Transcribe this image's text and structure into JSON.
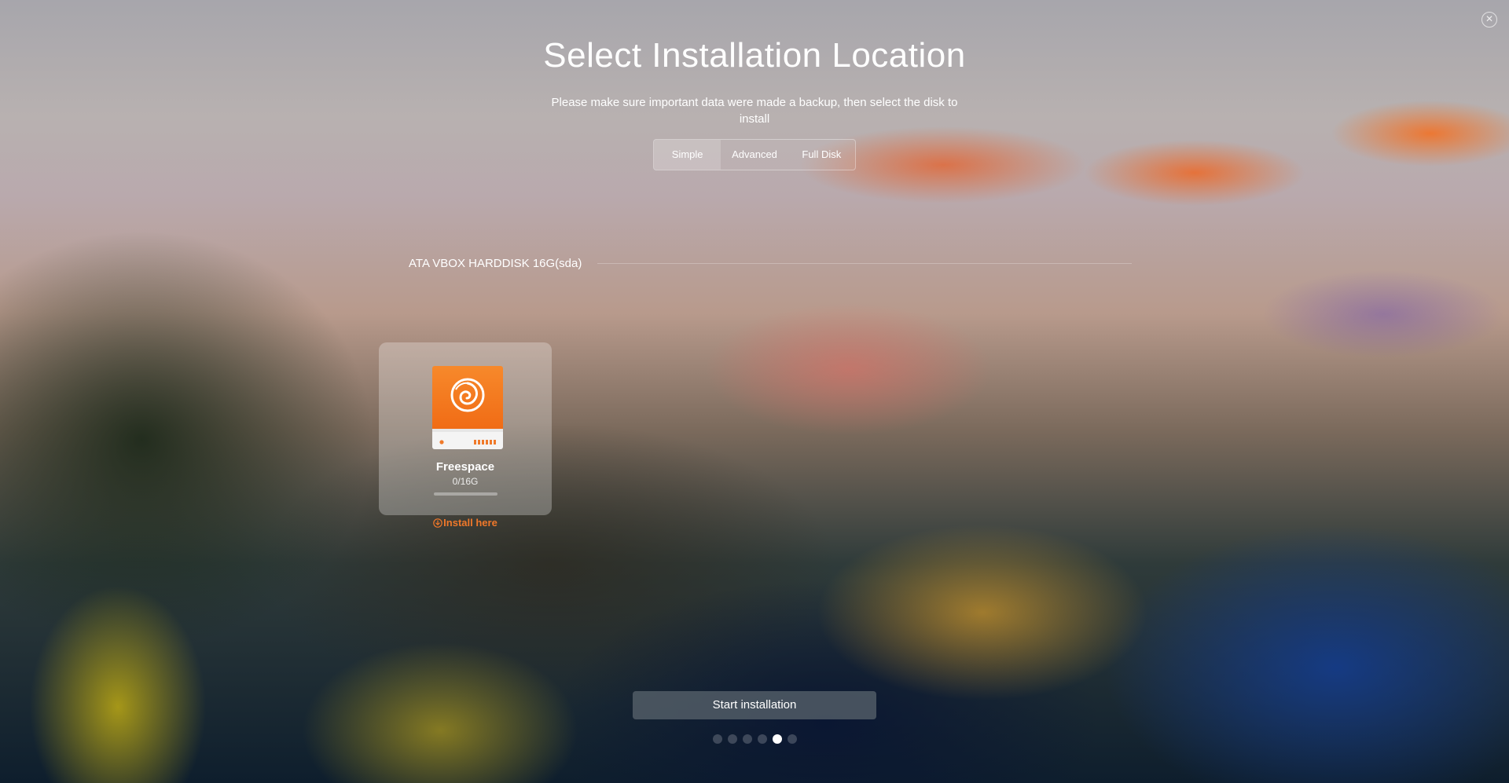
{
  "window": {
    "close_icon": "close-icon",
    "close_glyph": "✕"
  },
  "header": {
    "title": "Select Installation Location",
    "subtitle": "Please make sure important data were made a backup, then select the disk to install"
  },
  "tabs": [
    {
      "label": "Simple",
      "active": true
    },
    {
      "label": "Advanced",
      "active": false
    },
    {
      "label": "Full Disk",
      "active": false
    }
  ],
  "disk": {
    "name": "ATA VBOX HARDDISK 16G(sda)",
    "partitions": [
      {
        "name": "Freespace",
        "size": "0/16G",
        "usage_fraction": 0,
        "icon": "deepin-drive-icon",
        "action_label": "Install here",
        "action_icon": "install-icon"
      }
    ]
  },
  "footer": {
    "start_label": "Start installation",
    "steps_total": 6,
    "active_step": 5
  },
  "colors": {
    "accent": "#f0782a",
    "drive_orange": "#f57c1f"
  }
}
